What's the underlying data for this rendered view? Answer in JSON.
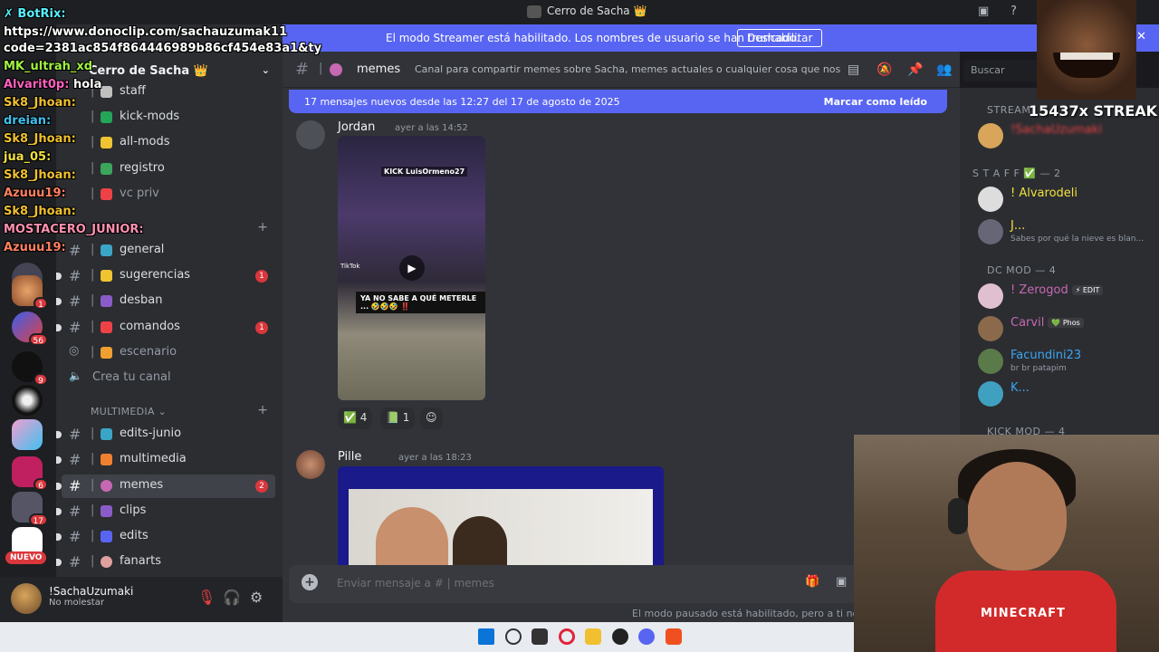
{
  "window": {
    "title": "Cerro de Sacha 👑"
  },
  "streamer_bar": {
    "message": "El modo Streamer está habilitado. Los nombres de usuario se han truncado.",
    "button": "Deshabilitar",
    "close": "✕"
  },
  "server": {
    "name": "Cerro de Sacha 👑"
  },
  "server_badges": [
    "1",
    "56",
    "9",
    "6",
    "17"
  ],
  "nuevo": "NUEVO",
  "categories": {
    "multimedia": "MULTIMEDIA"
  },
  "channels": [
    {
      "label": "staff",
      "unread": "",
      "emoji_color": "#c0c0c0"
    },
    {
      "label": "kick-mods",
      "unread": "",
      "emoji_color": "#23a55a"
    },
    {
      "label": "all-mods",
      "unread": "",
      "emoji_color": "#f0c330"
    },
    {
      "label": "registro",
      "unread": "",
      "emoji_color": "#3ba55c"
    },
    {
      "label": "vc priv",
      "unread": "",
      "emoji_color": "#ed4245"
    },
    {
      "label": "general",
      "unread": "",
      "emoji_color": "#3ba5c7"
    },
    {
      "label": "sugerencias",
      "unread": "1",
      "emoji_color": "#f0c330"
    },
    {
      "label": "desban",
      "unread": "",
      "emoji_color": "#8a5cc7"
    },
    {
      "label": "comandos",
      "unread": "1",
      "emoji_color": "#ed4245"
    },
    {
      "label": "escenario",
      "unread": "",
      "emoji_color": "#f0a030"
    },
    {
      "label": "Crea tu canal",
      "unread": "",
      "emoji_color": "#b5bac1"
    },
    {
      "label": "edits-junio",
      "unread": "",
      "emoji_color": "#3ba5c7"
    },
    {
      "label": "multimedia",
      "unread": "",
      "emoji_color": "#f08030"
    },
    {
      "label": "memes",
      "unread": "2",
      "emoji_color": "#c768b3"
    },
    {
      "label": "clips",
      "unread": "",
      "emoji_color": "#8a5cc7"
    },
    {
      "label": "edits",
      "unread": "",
      "emoji_color": "#5865f2"
    },
    {
      "label": "fanarts",
      "unread": "",
      "emoji_color": "#e0a0a0"
    }
  ],
  "user": {
    "name": "!SachaUzumaki",
    "status": "No molestar"
  },
  "channel_header": {
    "name": "memes",
    "topic": "Canal para compartir memes sobre Sacha, memes actuales o cualquier cosa que nos haga r...",
    "search_placeholder": "Buscar"
  },
  "new_messages": {
    "text": "17 mensajes nuevos desde las 12:27 del 17 de agosto de 2025",
    "mark_read": "Marcar como leído"
  },
  "messages": [
    {
      "author": "Jordan",
      "time": "ayer a las 14:52",
      "video_kick": "KICK LuisOrmeno27",
      "video_caption": "YA NO SABE A QUÉ METERLE ... 🤣🤣🤣 ‼️",
      "video_tiktok": "TikTok",
      "reactions": [
        {
          "emoji": "✅",
          "count": "4"
        },
        {
          "emoji": "📗",
          "count": "1"
        }
      ]
    },
    {
      "author": "Pille",
      "time": "ayer a las 18:23"
    }
  ],
  "composer": {
    "placeholder": "Enviar mensaje a #",
    "channel": "memes"
  },
  "paused_notice": "El modo pausado está habilitado, pero a ti no te a",
  "members": {
    "groups": [
      {
        "label": "STREAM",
        "count": ""
      },
      {
        "label": "S T A F F ✅ — 2",
        "count": ""
      },
      {
        "label": "DC MOD — 4",
        "count": ""
      },
      {
        "label": "KICK MOD — 4",
        "count": ""
      }
    ],
    "list": [
      {
        "name": "!SachaUzumaki",
        "status": "",
        "color": "#ed4245",
        "tag": ""
      },
      {
        "name": "! Alvarodeli",
        "status": "",
        "color": "#f0e040",
        "tag": ""
      },
      {
        "name": "J...",
        "status": "Sabes por qué la nieve es blan...",
        "color": "#f0e040",
        "tag": ""
      },
      {
        "name": "! Zerogod",
        "status": "",
        "color": "#c768b3",
        "tag": "⚡ EDIT"
      },
      {
        "name": "Carvil",
        "status": "",
        "color": "#c768b3",
        "tag": "💚 Phos"
      },
      {
        "name": "Facundini23",
        "status": "br br patapim",
        "color": "#3ba5f2",
        "tag": ""
      },
      {
        "name": "K...",
        "status": "",
        "color": "#3ba5f2",
        "tag": ""
      }
    ]
  },
  "overlay": {
    "streak": "15437x STREAK",
    "chat": [
      {
        "user": "✗ BotRix:",
        "text": "",
        "color": "#59f0ff"
      },
      {
        "user": "",
        "text": "https://www.donoclip.com/sachauzumak11",
        "color": "#ffffff"
      },
      {
        "user": "",
        "text": "code=2381ac854f864446989b86cf454e83a1&ty",
        "color": "#ffffff"
      },
      {
        "user": "MK_ultrah_xd",
        "text": "",
        "color": "#a0f040"
      },
      {
        "user": "Alvarit0p:",
        "text": "hola",
        "color": "#ff60c0"
      },
      {
        "user": "Sk8_Jhoan:",
        "text": "",
        "color": "#f0c030"
      },
      {
        "user": "dreian:",
        "text": "",
        "color": "#40c0f0"
      },
      {
        "user": "Sk8_Jhoan:",
        "text": "",
        "color": "#f0c030"
      },
      {
        "user": "jua_05:",
        "text": "",
        "color": "#f0e040"
      },
      {
        "user": "Sk8_Jhoan:",
        "text": "",
        "color": "#f0c030"
      },
      {
        "user": "Azuuu19:",
        "text": "",
        "color": "#ff8060"
      },
      {
        "user": "Sk8_Jhoan:",
        "text": "",
        "color": "#f0c030"
      },
      {
        "user": "MOSTACERO_JUNIOR:",
        "text": "",
        "color": "#ff90b0"
      },
      {
        "user": "Azuuu19:",
        "text": "",
        "color": "#ff8060"
      }
    ],
    "webcam_shirt": "MINECRAFT"
  }
}
